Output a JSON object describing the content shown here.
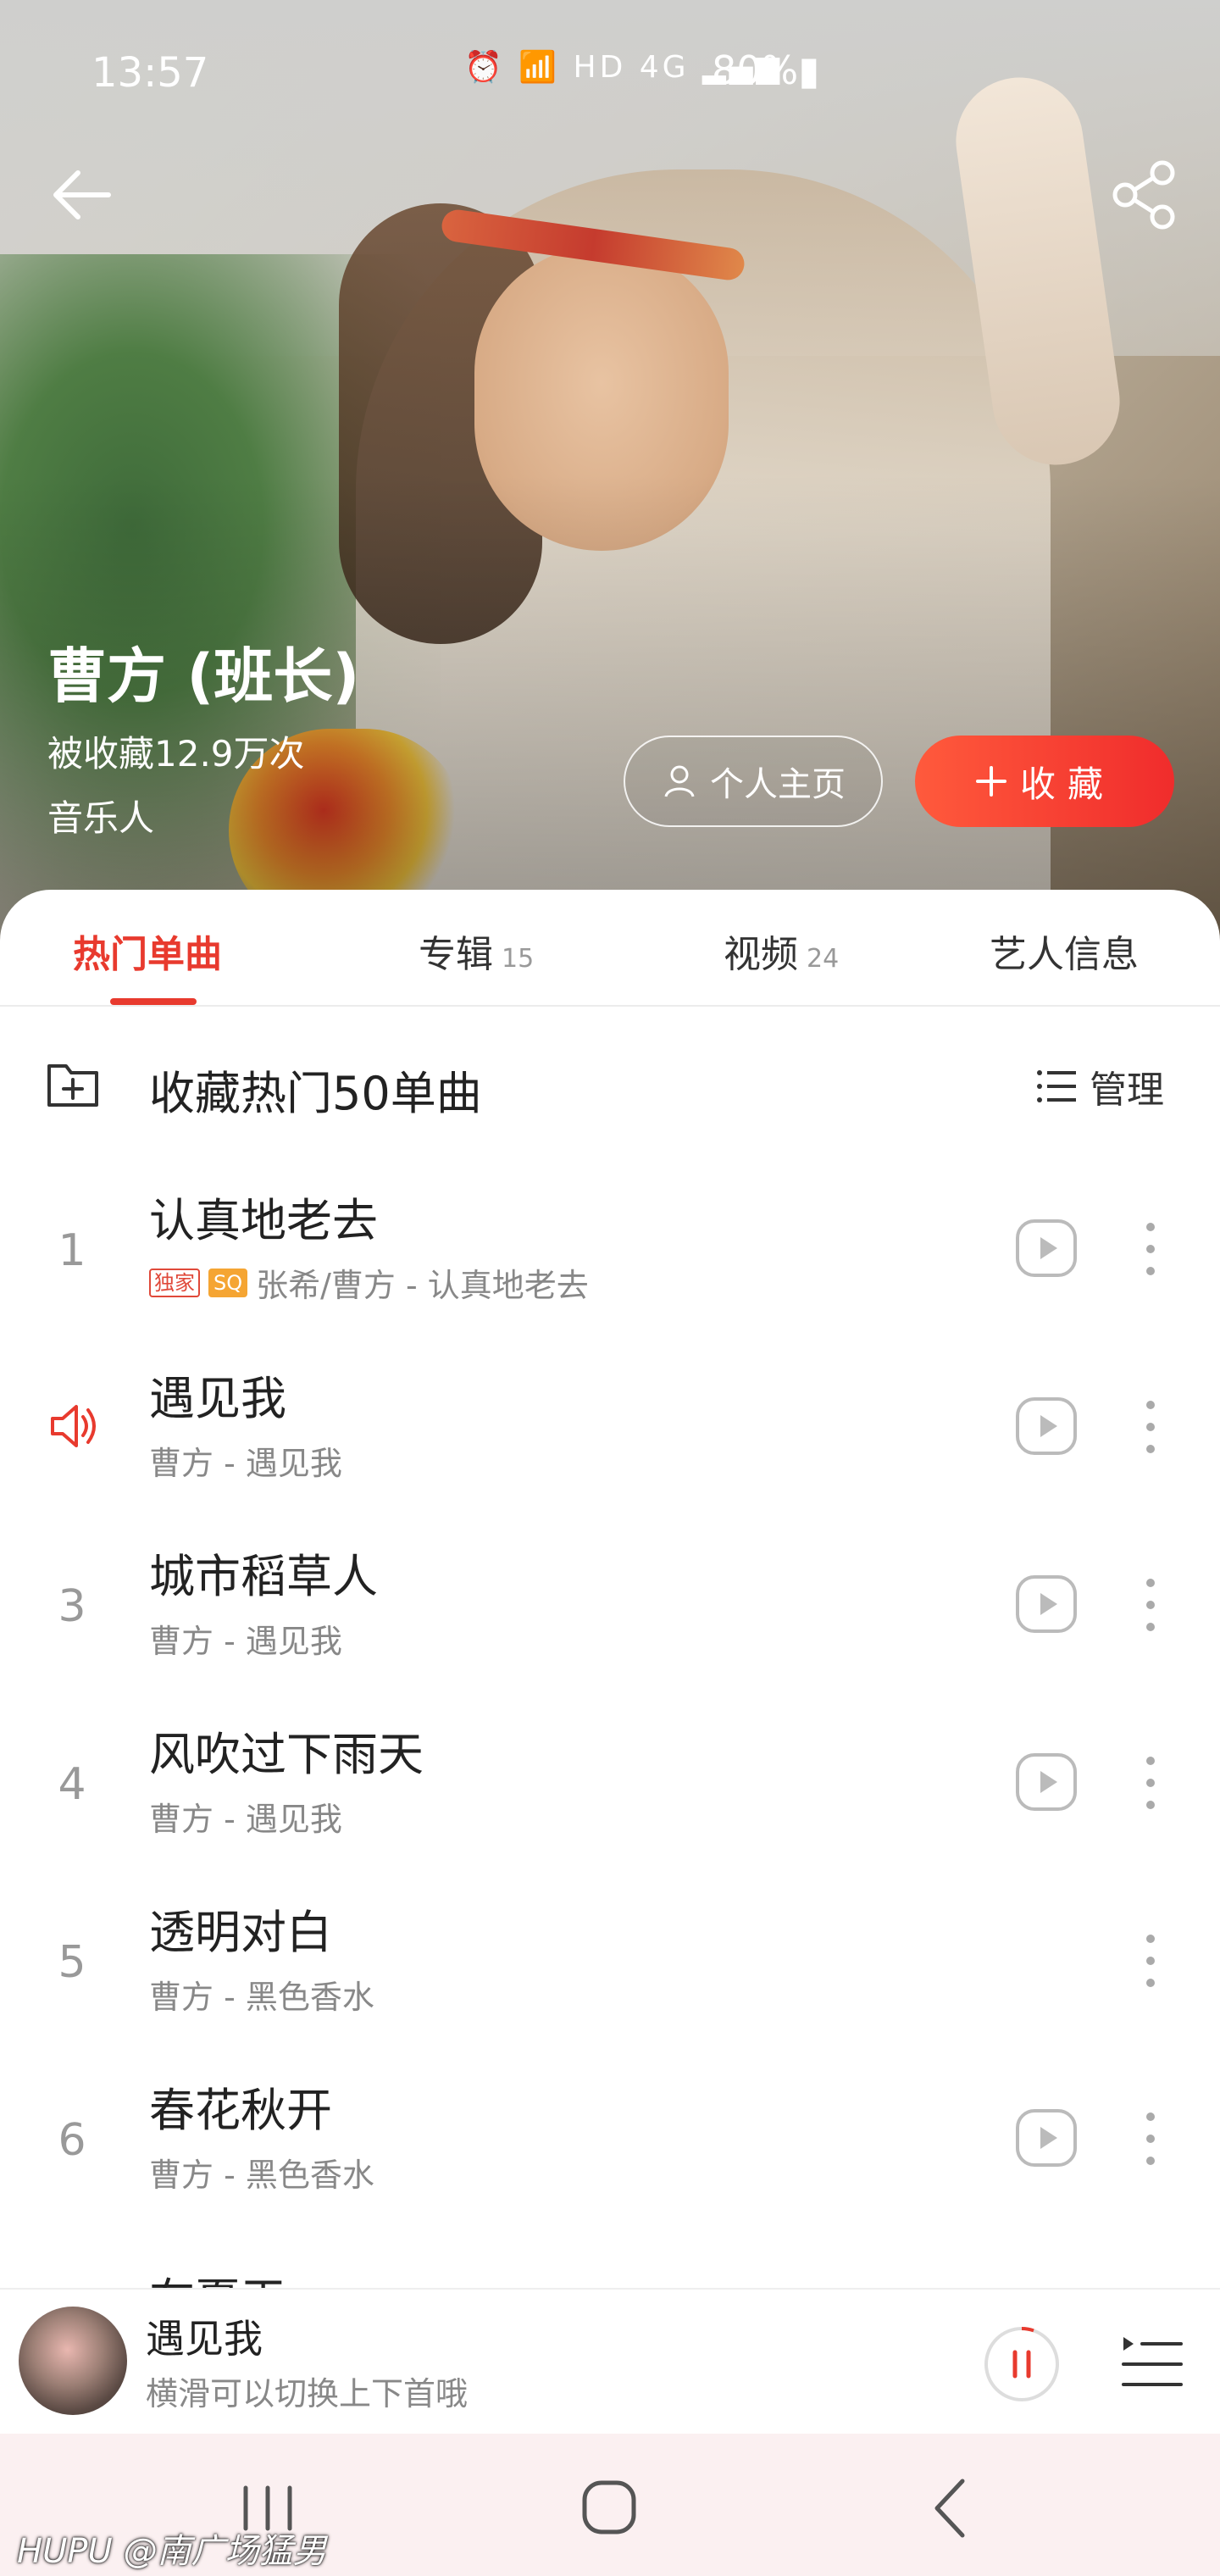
{
  "status_bar": {
    "time": "13:57",
    "icons": "⏰ 📶 HD 4G ▂▄▆",
    "battery": "80%▮"
  },
  "artist": {
    "name": "曹方 (班长)",
    "fav_count": "被收藏12.9万次",
    "role": "音乐人"
  },
  "buttons": {
    "profile": "个人主页",
    "collect": "收藏"
  },
  "tabs": [
    {
      "label": "热门单曲",
      "count": ""
    },
    {
      "label": "专辑",
      "count": "15"
    },
    {
      "label": "视频",
      "count": "24"
    },
    {
      "label": "艺人信息",
      "count": ""
    }
  ],
  "collect_bar": {
    "label": "收藏热门50单曲",
    "manage": "管理"
  },
  "songs": [
    {
      "num": "1",
      "title": "认真地老去",
      "badges": [
        "独家",
        "SQ"
      ],
      "sub": "张希/曹方 - 认真地老去",
      "playing": false
    },
    {
      "num": "",
      "title": "遇见我",
      "sub": "曹方 - 遇见我",
      "playing": true
    },
    {
      "num": "3",
      "title": "城市稻草人",
      "sub": "曹方 - 遇见我",
      "playing": false
    },
    {
      "num": "4",
      "title": "风吹过下雨天",
      "sub": "曹方 - 遇见我",
      "playing": false
    },
    {
      "num": "5",
      "title": "透明对白",
      "sub": "曹方 - 黑色香水",
      "playing": false
    },
    {
      "num": "6",
      "title": "春花秋开",
      "sub": "曹方 - 黑色香水",
      "playing": false
    },
    {
      "num": "",
      "title": "在夏天",
      "sub": "",
      "playing": false
    }
  ],
  "mini_player": {
    "title": "遇见我",
    "hint": "横滑可以切换上下首哦"
  },
  "watermark": "HUPU @南广场猛男",
  "colors": {
    "accent": "#e83a2e",
    "collect_btn": "#f5412f",
    "nav_bg": "#fbf0f1"
  }
}
